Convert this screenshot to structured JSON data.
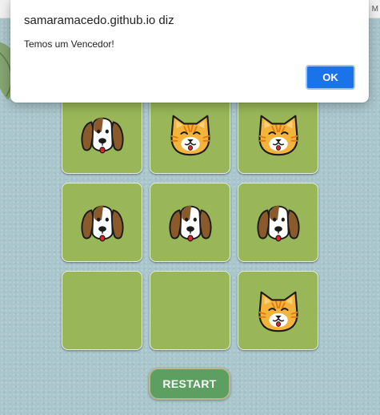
{
  "browser": {
    "top_right_text": "M"
  },
  "dialog": {
    "title": "samaramacedo.github.io diz",
    "message": "Temos um Vencedor!",
    "ok_label": "OK"
  },
  "board": {
    "cells": [
      "dog",
      "cat",
      "cat",
      "dog",
      "dog",
      "dog",
      "empty",
      "empty",
      "cat"
    ],
    "winning_line": "middle-row"
  },
  "restart_label": "RESTART",
  "colors": {
    "background": "#a9c6cc",
    "cell": "#99b758",
    "restart_button": "#5d9e61",
    "ok_button": "#1a73e8"
  }
}
